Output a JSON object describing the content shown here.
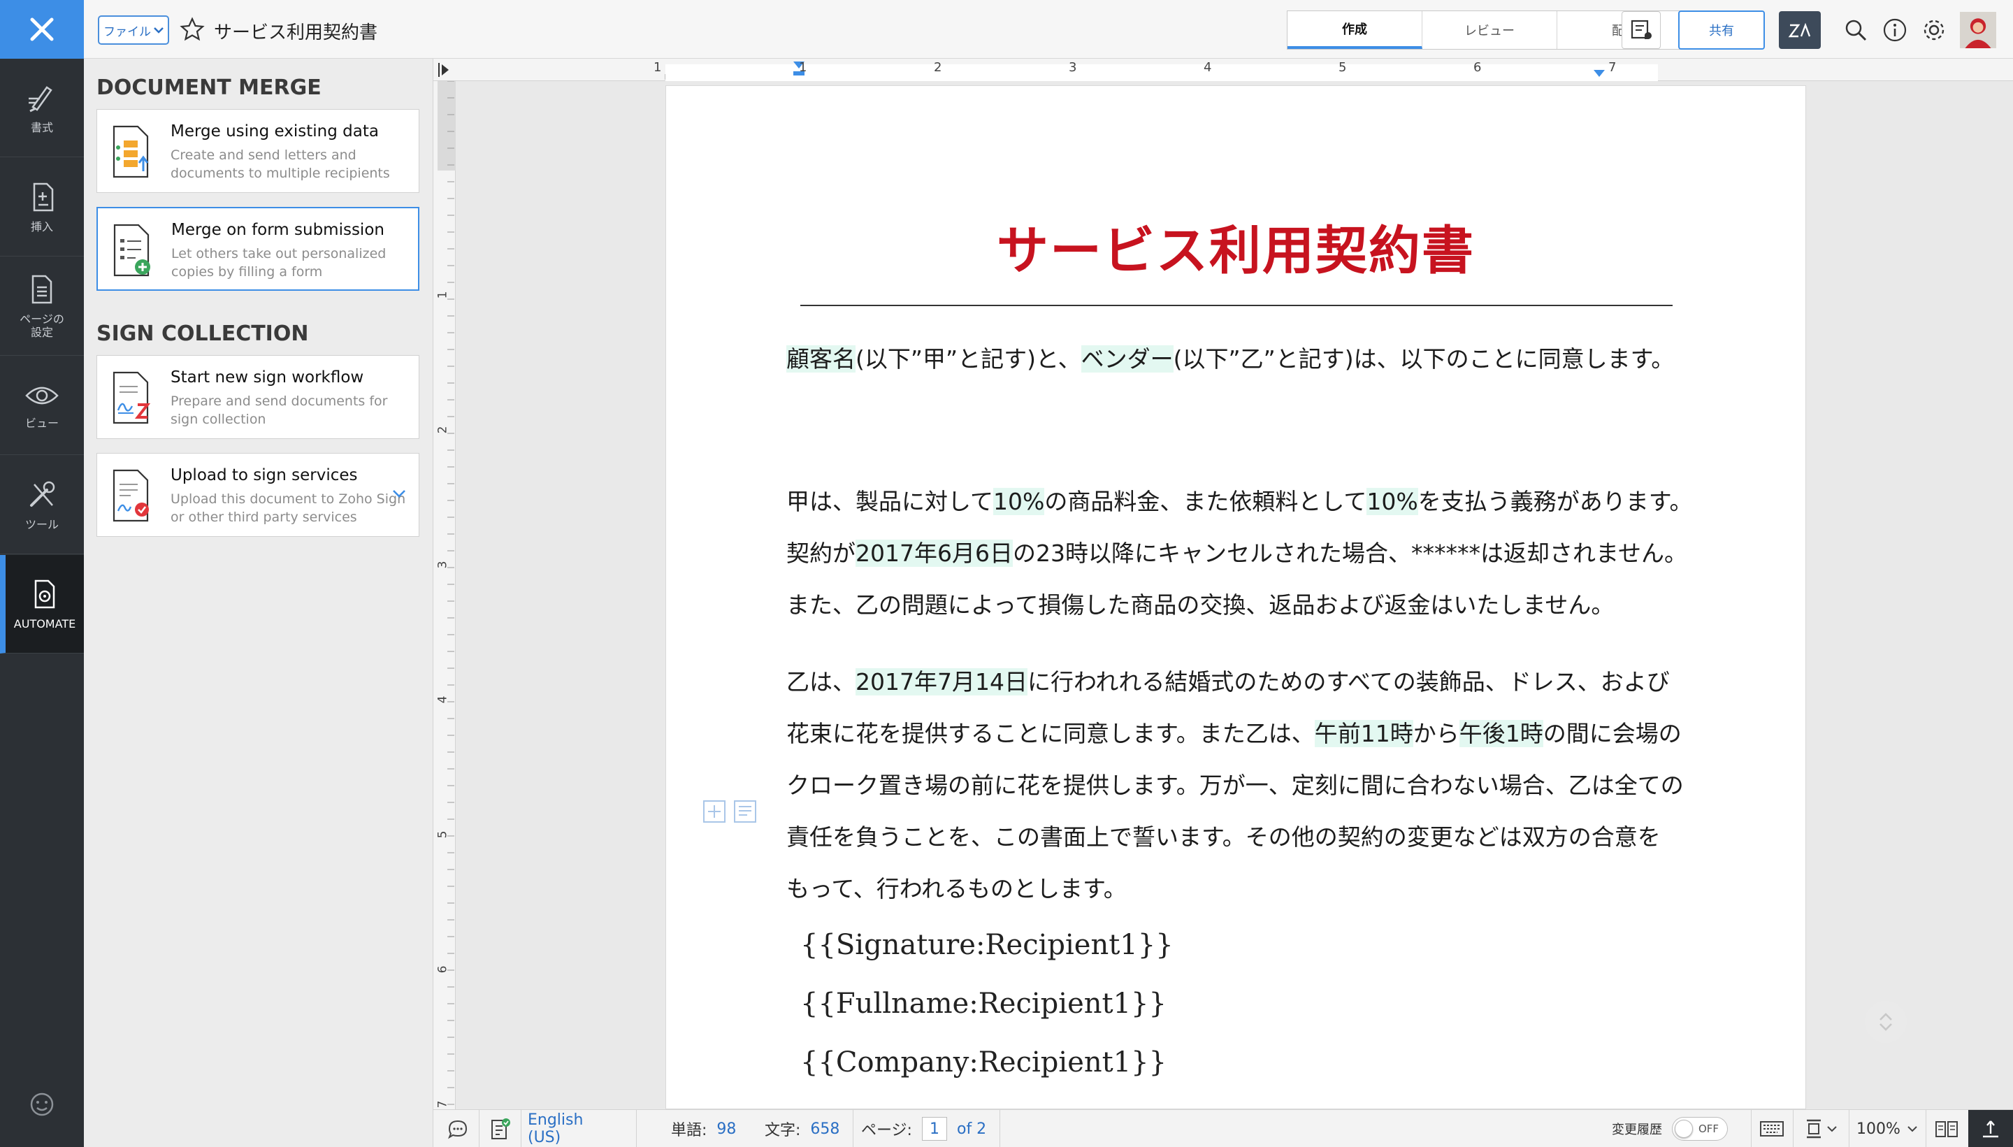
{
  "left_rail": {
    "items": [
      {
        "label": "書式",
        "icon": "brush-icon"
      },
      {
        "label": "挿入",
        "icon": "insert-icon"
      },
      {
        "label": "ページの\n設定",
        "icon": "page-setup-icon"
      },
      {
        "label": "ビュー",
        "icon": "eye-icon"
      },
      {
        "label": "ツール",
        "icon": "tools-icon"
      },
      {
        "label": "AUTOMATE",
        "icon": "automate-icon"
      }
    ],
    "active": "AUTOMATE"
  },
  "topbar": {
    "file_label": "ファイル",
    "doc_title": "サービス利用契約書",
    "tabs": [
      "作成",
      "レビュー",
      "配分"
    ],
    "active_tab": "作成",
    "share_label": "共有"
  },
  "panel": {
    "merge_heading": "DOCUMENT MERGE",
    "sign_heading": "SIGN COLLECTION",
    "cards": [
      {
        "title": "Merge using existing data",
        "desc": "Create and send letters and documents to multiple recipients"
      },
      {
        "title": "Merge on form submission",
        "desc": "Let others take out personalized copies by filling a form"
      },
      {
        "title": "Start new sign workflow",
        "desc": "Prepare and send documents for sign collection"
      },
      {
        "title": "Upload to sign services",
        "desc": "Upload this document to Zoho Sign or other third party services"
      }
    ]
  },
  "rulers": {
    "h_labels": [
      "1",
      "1",
      "2",
      "3",
      "4",
      "5",
      "6",
      "7"
    ],
    "v_labels": [
      "1",
      "2",
      "3",
      "4",
      "5",
      "6",
      "7"
    ]
  },
  "document": {
    "heading": "サービス利用契約書",
    "intro": {
      "f1": "顧客名",
      "t1": "(以下”甲”と記す)と、",
      "f2": "ベンダー",
      "t2": "(以下”乙”と記す)は、以下のことに同意します。"
    },
    "p1_line1": {
      "t1": "甲は、製品に対して",
      "f1": "10%",
      "t2": "の商品料金、また依頼料として",
      "f2": "10%",
      "t3": "を支払う義務があります。"
    },
    "p1_line2": {
      "t1": "契約が",
      "f1": "2017年6月6日",
      "t2": "の23時以降にキャンセルされた場合、******は返却されません。"
    },
    "p1_line3": "また、乙の問題によって損傷した商品の交換、返品および返金はいたしません。",
    "p2_line1": {
      "t1": "乙は、",
      "f1": "2017年7月14日",
      "t2": "に行われれる結婚式のためのすべての装飾品、ドレス、および"
    },
    "p2_line2": {
      "t1": "花束に花を提供することに同意します。また乙は、",
      "f1": "午前11時",
      "t2": "から",
      "f2": "午後1時",
      "t3": "の間に会場の"
    },
    "p2_line3": "クローク置き場の前に花を提供します。万が一、定刻に間に合わない場合、乙は全ての",
    "p2_line4": "責任を負うことを、この書面上で誓います。その他の契約の変更などは双方の合意を",
    "p2_line5": "もって、行われるものとします。",
    "fields": [
      "{{Signature:Recipient1}}",
      "{{Fullname:Recipient1}}",
      "{{Company:Recipient1}}"
    ]
  },
  "statusbar": {
    "language": "English (US)",
    "words_label": "単語:",
    "words": "98",
    "chars_label": "文字:",
    "chars": "658",
    "page_label": "ページ:",
    "page_current": "1",
    "page_of": "of 2",
    "track_label": "変更履歴",
    "track_state": "OFF",
    "zoom": "100%"
  },
  "colors": {
    "accent": "#3d8ee6",
    "heading_red": "#c7131f",
    "field_highlight": "#e3f8f1",
    "rail": "#2c3035"
  }
}
